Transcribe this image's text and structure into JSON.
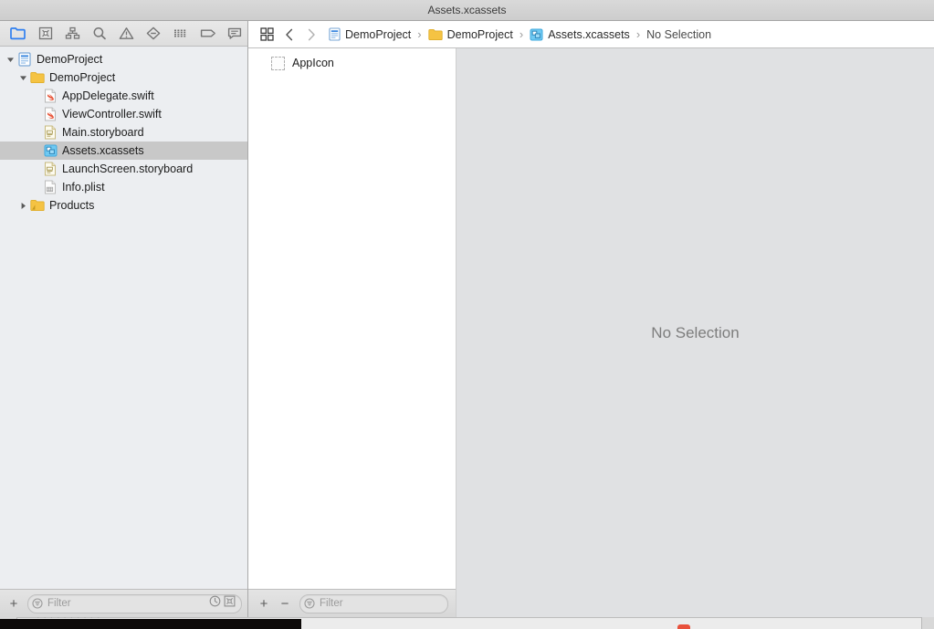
{
  "window": {
    "title": "Assets.xcassets"
  },
  "navigator": {
    "toolbar": [
      {
        "name": "project-navigator-icon",
        "label": "Project Navigator",
        "selected": true
      },
      {
        "name": "source-control-navigator-icon",
        "label": "Source Control Navigator",
        "selected": false
      },
      {
        "name": "symbol-navigator-icon",
        "label": "Symbol Navigator",
        "selected": false
      },
      {
        "name": "find-navigator-icon",
        "label": "Find Navigator",
        "selected": false
      },
      {
        "name": "issue-navigator-icon",
        "label": "Issue Navigator",
        "selected": false
      },
      {
        "name": "test-navigator-icon",
        "label": "Test Navigator",
        "selected": false
      },
      {
        "name": "debug-navigator-icon",
        "label": "Debug Navigator",
        "selected": false
      },
      {
        "name": "breakpoint-navigator-icon",
        "label": "Breakpoint Navigator",
        "selected": false
      },
      {
        "name": "report-navigator-icon",
        "label": "Report Navigator",
        "selected": false
      }
    ],
    "tree": [
      {
        "label": "DemoProject",
        "icon": "xcode-project-icon",
        "indent": 0,
        "disclosure": "open",
        "selected": false
      },
      {
        "label": "DemoProject",
        "icon": "folder-icon",
        "indent": 1,
        "disclosure": "open",
        "selected": false
      },
      {
        "label": "AppDelegate.swift",
        "icon": "swift-file-icon",
        "indent": 2,
        "disclosure": "none",
        "selected": false
      },
      {
        "label": "ViewController.swift",
        "icon": "swift-file-icon",
        "indent": 2,
        "disclosure": "none",
        "selected": false
      },
      {
        "label": "Main.storyboard",
        "icon": "storyboard-file-icon",
        "indent": 2,
        "disclosure": "none",
        "selected": false
      },
      {
        "label": "Assets.xcassets",
        "icon": "assets-catalog-icon",
        "indent": 2,
        "disclosure": "none",
        "selected": true
      },
      {
        "label": "LaunchScreen.storyboard",
        "icon": "storyboard-file-icon",
        "indent": 2,
        "disclosure": "none",
        "selected": false
      },
      {
        "label": "Info.plist",
        "icon": "plist-file-icon",
        "indent": 2,
        "disclosure": "none",
        "selected": false
      },
      {
        "label": "Products",
        "icon": "folder-icon",
        "indent": 1,
        "disclosure": "closed",
        "selected": false
      }
    ],
    "filter_bar": {
      "add_label": "+",
      "placeholder": "Filter",
      "filter_icon": "filter-icon",
      "recent_icon": "clock-icon",
      "scope_icon": "source-control-filter-icon"
    }
  },
  "editor": {
    "grid_icon": "assistant-grid-icon",
    "back_label": "‹",
    "forward_label": "›",
    "breadcrumbs": [
      {
        "label": "DemoProject",
        "icon": "xcode-project-icon"
      },
      {
        "label": "DemoProject",
        "icon": "folder-icon"
      },
      {
        "label": "Assets.xcassets",
        "icon": "assets-catalog-icon"
      },
      {
        "label": "No Selection",
        "icon": "none"
      }
    ],
    "separator": "›",
    "asset_list": {
      "items": [
        {
          "label": "AppIcon",
          "icon": "image-placeholder-icon"
        }
      ],
      "filter_bar": {
        "add_label": "+",
        "remove_label": "−",
        "placeholder": "Filter",
        "filter_icon": "filter-icon"
      }
    },
    "detail": {
      "empty_message": "No Selection"
    }
  },
  "background": {
    "ghost_text": "· · · · · · · · · ·"
  },
  "colors": {
    "accent": "#2f7ff0",
    "folder": "#f5c343",
    "assets_blue": "#5ec3f2",
    "window_chrome": "#ececec",
    "detail_bg": "#e0e1e3"
  }
}
